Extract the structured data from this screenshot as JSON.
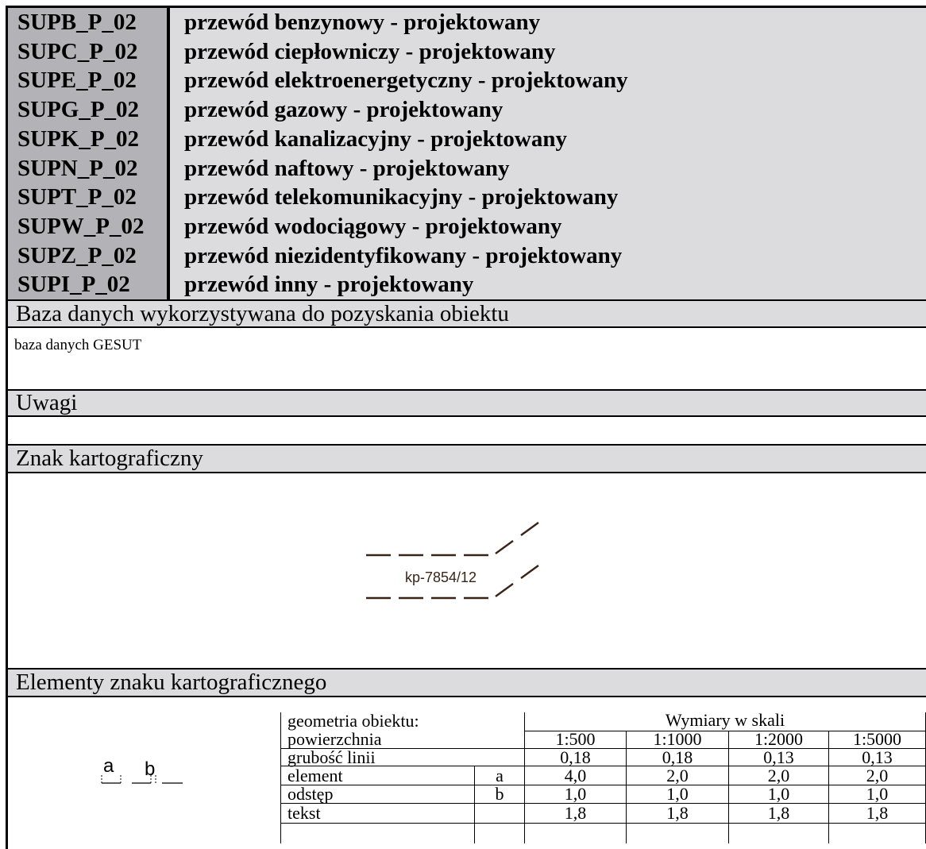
{
  "objects": [
    {
      "code": "SUPB_P_02",
      "description": "przewód benzynowy - projektowany"
    },
    {
      "code": "SUPC_P_02",
      "description": "przewód ciepłowniczy - projektowany"
    },
    {
      "code": "SUPE_P_02",
      "description": "przewód elektroenergetyczny - projektowany"
    },
    {
      "code": "SUPG_P_02",
      "description": "przewód gazowy - projektowany"
    },
    {
      "code": "SUPK_P_02",
      "description": "przewód kanalizacyjny - projektowany"
    },
    {
      "code": "SUPN_P_02",
      "description": "przewód naftowy - projektowany"
    },
    {
      "code": "SUPT_P_02",
      "description": "przewód telekomunikacyjny - projektowany"
    },
    {
      "code": "SUPW_P_02",
      "description": "przewód wodociągowy - projektowany"
    },
    {
      "code": "SUPZ_P_02",
      "description": "przewód niezidentyfikowany - projektowany"
    },
    {
      "code": "SUPI_P_02",
      "description": "przewód inny - projektowany"
    }
  ],
  "database": {
    "heading": "Baza danych wykorzystywana do pozyskania obiektu",
    "value": "baza danych GESUT"
  },
  "remarks": {
    "heading": "Uwagi",
    "value": ""
  },
  "symbol": {
    "heading": "Znak kartograficzny",
    "label": "kp-7854/12"
  },
  "elements": {
    "heading": "Elementy znaku kartograficznego",
    "diagram_labels": [
      "a",
      "b"
    ],
    "geometry_label": "geometria obiektu:",
    "geometry_value": "powierzchnia",
    "dimensions_header": "Wymiary w skali",
    "scales": [
      "1:500",
      "1:1000",
      "1:2000",
      "1:5000"
    ],
    "rows": [
      {
        "label": "grubość linii",
        "key": "",
        "values": [
          "0,18",
          "0,18",
          "0,13",
          "0,13"
        ]
      },
      {
        "label": "element",
        "key": "a",
        "values": [
          "4,0",
          "2,0",
          "2,0",
          "2,0"
        ]
      },
      {
        "label": "odstęp",
        "key": "b",
        "values": [
          "1,0",
          "1,0",
          "1,0",
          "1,0"
        ]
      },
      {
        "label": "tekst",
        "key": "",
        "values": [
          "1,8",
          "1,8",
          "1,8",
          "1,8"
        ]
      }
    ]
  },
  "colors": {
    "header_gray": "#dcdcde",
    "code_gray": "#b3b3b7",
    "symbol_brown": "#3a2418"
  }
}
